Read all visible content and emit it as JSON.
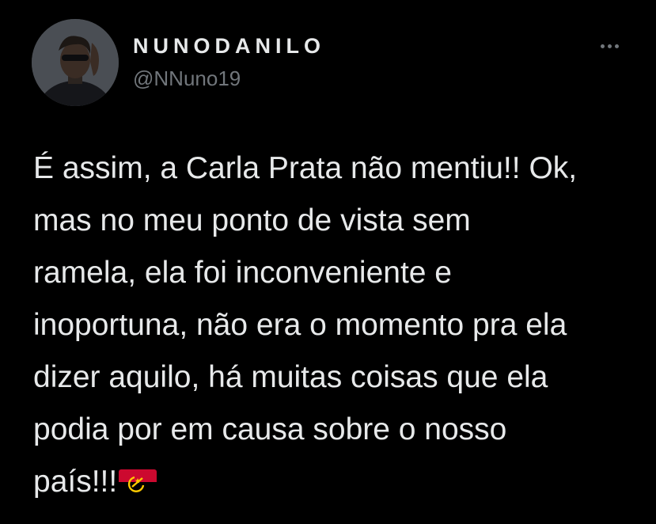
{
  "tweet": {
    "author": {
      "display_name": "NUNODANILO",
      "handle": "@NNuno19"
    },
    "more_icon": "ellipsis-icon",
    "text_lines": [
      "É assim, a Carla Prata não mentiu!! Ok,",
      "mas no meu ponto de vista sem",
      "ramela, ela foi inconveniente e",
      "inoportuna, não era o momento pra ela",
      "dizer aquilo, há muitas coisas que ela",
      "podia por em causa sobre o nosso",
      "país!!!"
    ],
    "emoji": "angola-flag-icon"
  },
  "colors": {
    "background": "#000000",
    "text_primary": "#e7e9ea",
    "text_secondary": "#71767b",
    "flag_red": "#cc092f",
    "flag_black": "#000000",
    "flag_yellow": "#ffcb00"
  }
}
